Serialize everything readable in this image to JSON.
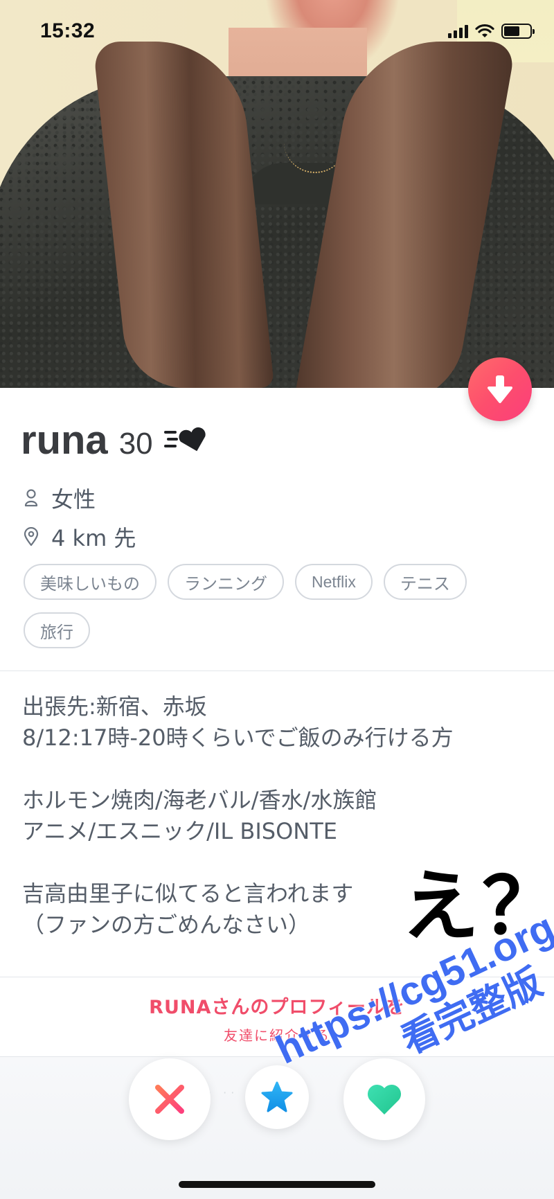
{
  "status_bar": {
    "time": "15:32"
  },
  "profile": {
    "name": "runa",
    "age": "30",
    "badge_icon": "heart-speed-icon",
    "gender": "女性",
    "distance": "4 km 先",
    "interests": [
      "美味しいもの",
      "ランニング",
      "Netflix",
      "テニス",
      "旅行"
    ],
    "bio": [
      "出張先:新宿、赤坂\n8/12:17時-20時くらいでご飯のみ行ける方",
      "ホルモン焼肉/海老バル/香水/水族館\nアニメ/エスニック/IL BISONTE",
      "吉高由里子に似てると言われます\n（ファンの方ごめんなさい）"
    ]
  },
  "overlay_text": "え？",
  "share": {
    "line1": "RUNAさんのプロフィールを",
    "line2": "友達に紹介する"
  },
  "actions": {
    "nope_icon": "close-icon",
    "super_like_icon": "star-icon",
    "like_icon": "heart-icon",
    "faint_label": "· ··"
  },
  "watermark": {
    "line1": "https://cg51.org",
    "line2": "看完整版"
  },
  "colors": {
    "accent": "#fd4e6d",
    "nope": "#fe5a6a",
    "super_like": "#1aa0f2",
    "like": "#2ed6a4",
    "watermark": "#3f6cf2"
  }
}
